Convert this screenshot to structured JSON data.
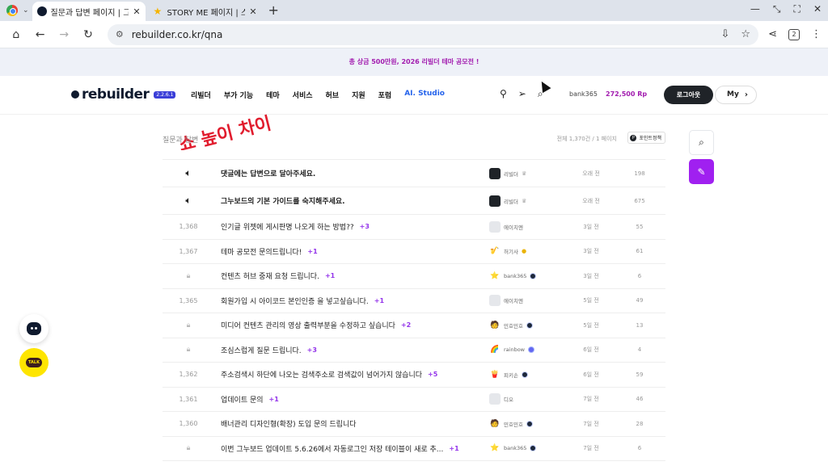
{
  "browser": {
    "tabs": [
      {
        "title": "질문과 답변 페이지 | 그누보드",
        "active": true,
        "icon": "rebuilder-favicon"
      },
      {
        "title": "STORY ME 페이지 | 스토리",
        "active": false,
        "icon": "star-favicon"
      }
    ],
    "url": "rebuilder.co.kr/qna",
    "tab_count": "2"
  },
  "promo": {
    "text": "총 상금 500만원, 2026 리빌더 테마 공모전 !"
  },
  "header": {
    "logo": "rebuilder",
    "version": "2.2.6.1",
    "nav": [
      "리빌더",
      "부가 기능",
      "테마",
      "서비스",
      "허브",
      "지원",
      "포럼",
      "AI. Studio"
    ],
    "user": "bank365",
    "points": "272,500 Rp",
    "logout": "로그아웃",
    "my": "My"
  },
  "annotation": {
    "text": "쇼 높이 차이"
  },
  "board": {
    "title": "질문과 답변",
    "count": "전체 1,370건 / 1 페이지",
    "point_policy": "포인트정책",
    "rows": [
      {
        "type": "notice",
        "num": "",
        "title": "댓글에는 답변으로 달아주세요.",
        "comments": "",
        "author": "리빌더",
        "avatar": "dark",
        "badge": "crown",
        "date": "오래 전",
        "views": "198"
      },
      {
        "type": "notice",
        "num": "",
        "title": "그누보드의 기본 가이드를 숙지해주세요.",
        "comments": "",
        "author": "리빌더",
        "avatar": "dark",
        "badge": "crown",
        "date": "오래 전",
        "views": "675"
      },
      {
        "type": "post",
        "num": "1,368",
        "title": "인기글 위젯에 게시판명 나오게 하는 방법??",
        "comments": "+3",
        "author": "에이치엔",
        "avatar": "grey",
        "badge": "",
        "date": "3일 전",
        "views": "55"
      },
      {
        "type": "post",
        "num": "1,367",
        "title": "테마 공모전 문의드립니다!",
        "comments": "+1",
        "author": "허기사",
        "avatar": "img",
        "badge": "gold",
        "date": "3일 전",
        "views": "61"
      },
      {
        "type": "locked",
        "num": "",
        "title": "컨텐츠 허브 중재 요청 드립니다.",
        "comments": "+1",
        "author": "bank365",
        "avatar": "img",
        "badge": "navy",
        "date": "3일 전",
        "views": "6"
      },
      {
        "type": "post",
        "num": "1,365",
        "title": "회원가입 시 아이코드 본인인증 을 넣고싶습니다.",
        "comments": "+1",
        "author": "에이치엔",
        "avatar": "grey",
        "badge": "",
        "date": "5일 전",
        "views": "49"
      },
      {
        "type": "locked",
        "num": "",
        "title": "미디어 컨텐츠 관리의 영상 출력부분을 수정하고 싶습니다",
        "comments": "+2",
        "author": "민호민호",
        "avatar": "img",
        "badge": "navy",
        "date": "5일 전",
        "views": "13"
      },
      {
        "type": "locked",
        "num": "",
        "title": "조심스럽게 질문 드립니다.",
        "comments": "+3",
        "author": "rainbow",
        "avatar": "img",
        "badge": "rainbow",
        "date": "6일 전",
        "views": "4"
      },
      {
        "type": "post",
        "num": "1,362",
        "title": "주소검색시 하단에 나오는 검색주소로 검색값이 넘어가지 않습니다",
        "comments": "+5",
        "author": "피키손",
        "avatar": "img",
        "badge": "navy",
        "date": "6일 전",
        "views": "59"
      },
      {
        "type": "post",
        "num": "1,361",
        "title": "업데이트 문의",
        "comments": "+1",
        "author": "디오",
        "avatar": "grey",
        "badge": "",
        "date": "7일 전",
        "views": "46"
      },
      {
        "type": "post",
        "num": "1,360",
        "title": "배너관리 디자인형(확장) 도입 문의 드립니다",
        "comments": "",
        "author": "민호민호",
        "avatar": "img",
        "badge": "navy",
        "date": "7일 전",
        "views": "28"
      },
      {
        "type": "locked",
        "num": "",
        "title": "이번 그누보드 업데이트 5.6.26에서 자동로그인 저장 테이블이 새로 추...",
        "comments": "+1",
        "author": "bank365",
        "avatar": "img",
        "badge": "navy",
        "date": "7일 전",
        "views": "6"
      }
    ]
  },
  "fab": {
    "talk": "TALK"
  },
  "colors": {
    "accent": "#a020f0",
    "promo": "#a21caf",
    "points": "#a21caf",
    "ai_studio": "#2563eb"
  }
}
